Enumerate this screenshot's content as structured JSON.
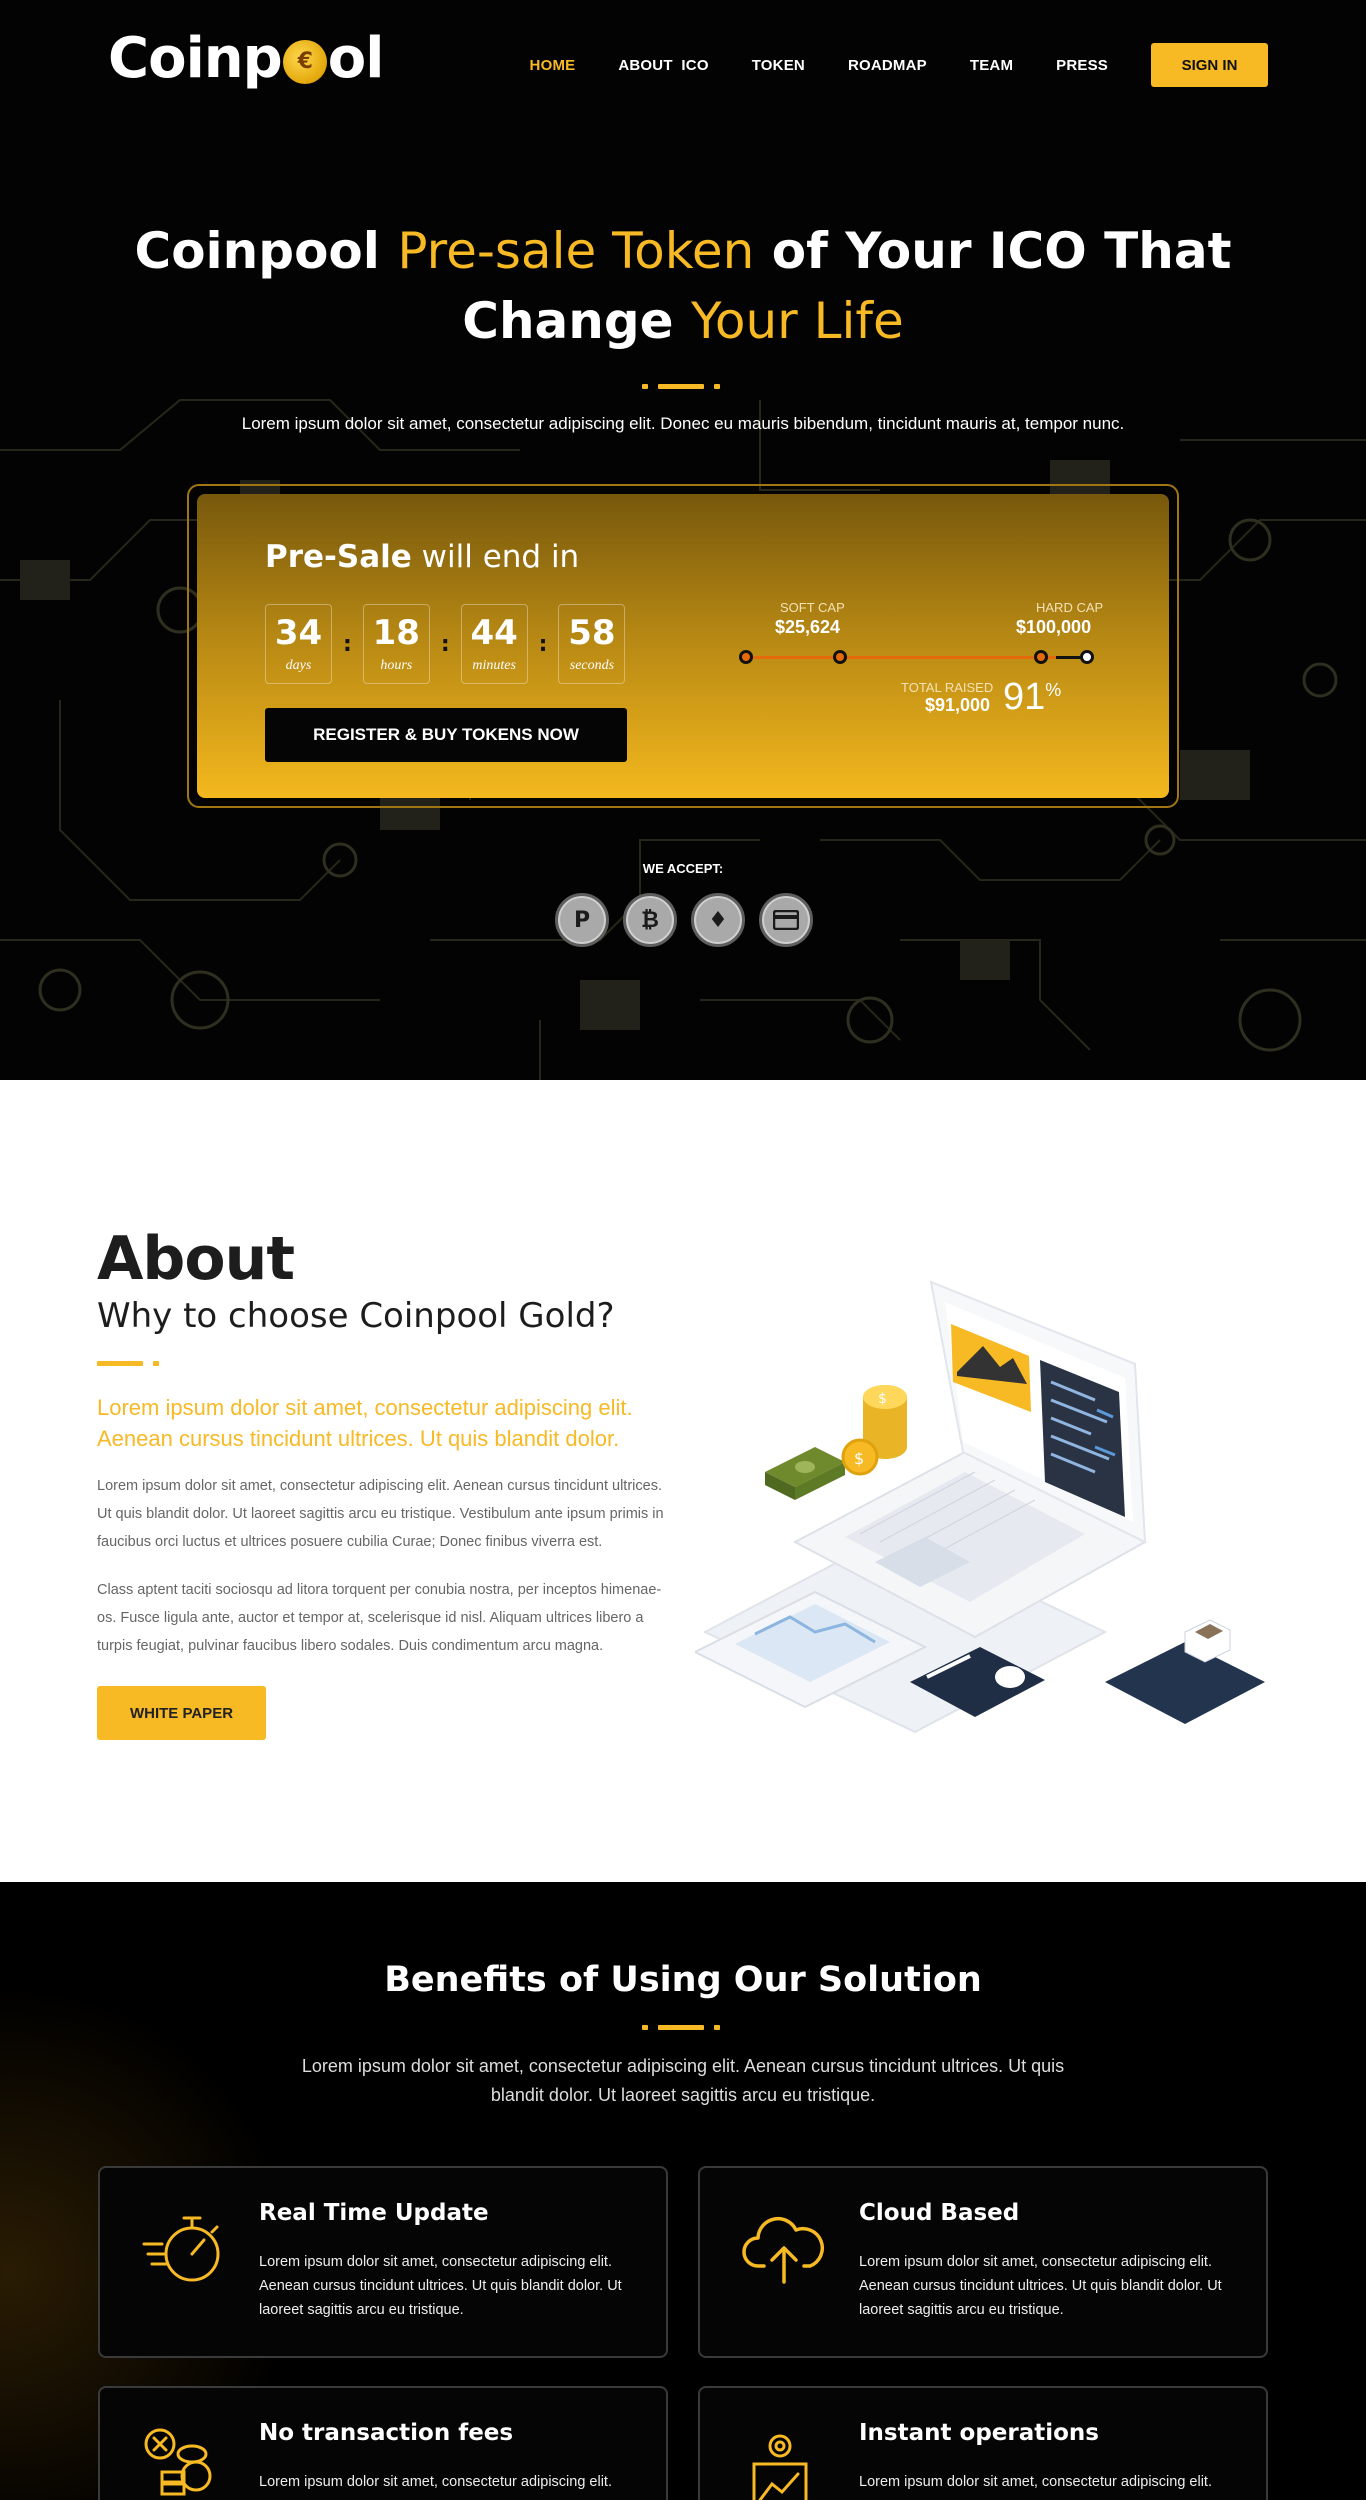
{
  "header": {
    "logo": {
      "pre": "Coinp",
      "post": "ol",
      "coin_glyph": "€"
    },
    "nav": [
      {
        "label": "HOME",
        "active": true
      },
      {
        "label": "ABOUT  ICO",
        "active": false
      },
      {
        "label": "TOKEN",
        "active": false
      },
      {
        "label": "ROADMAP",
        "active": false
      },
      {
        "label": "TEAM",
        "active": false
      },
      {
        "label": "PRESS",
        "active": false
      }
    ],
    "sign_in": "SIGN IN"
  },
  "hero": {
    "title_line1": {
      "a": "Coinpool",
      "b": "Pre-sale Token",
      "c": "of Your ICO That"
    },
    "title_line2": {
      "a": "Change",
      "b": "Your Life"
    },
    "subtitle": "Lorem ipsum dolor sit amet, consectetur adipiscing elit. Donec eu mauris bibendum, tincidunt mauris at, tempor nunc."
  },
  "presale": {
    "title_bold": "Pre-Sale",
    "title_rest": " will end in",
    "timer": [
      {
        "value": "34",
        "label": "days"
      },
      {
        "value": "18",
        "label": "hours"
      },
      {
        "value": "44",
        "label": "minutes"
      },
      {
        "value": "58",
        "label": "seconds"
      }
    ],
    "separator": ":",
    "button": "REGISTER & BUY TOKENS NOW",
    "soft_cap_label": "SOFT CAP",
    "soft_cap_value": "$25,624",
    "hard_cap_label": "HARD CAP",
    "hard_cap_value": "$100,000",
    "total_raised_label": "TOTAL RAISED",
    "total_raised_value": "$91,000",
    "percent": "91",
    "percent_sign": "%",
    "progress": 0.91
  },
  "accept": {
    "label": "WE ACCEPT:",
    "methods": [
      {
        "icon": "paypal-icon",
        "glyph": "P"
      },
      {
        "icon": "bitcoin-icon",
        "glyph": "₿"
      },
      {
        "icon": "ethereum-icon",
        "glyph": "♦"
      },
      {
        "icon": "credit-card-icon",
        "glyph": "▭"
      }
    ]
  },
  "about": {
    "heading": "About",
    "subheading": "Why to choose Coinpool Gold?",
    "lead": "Lorem ipsum dolor sit amet, consectetur adipiscing elit. Aenean cursus tincidunt ultrices. Ut quis blandit dolor.",
    "p1": "Lorem ipsum dolor sit amet, consectetur adipiscing elit. Aenean cursus tincidunt ultrices. Ut quis blandit dolor. Ut laoreet sagittis arcu eu tristique. Vestibulum ante ipsum primis in faucibus orci luctus et ultrices posuere cubilia Curae; Donec finibus viverra est.",
    "p2": "Class aptent taciti sociosqu ad litora torquent per conubia nostra, per inceptos himenae-os. Fusce ligula ante, auctor et tempor at, scelerisque id nisl. Aliquam ultrices libero a turpis feugiat, pulvinar faucibus libero sodales. Duis condimentum arcu magna.",
    "button": "WHITE PAPER"
  },
  "benefits": {
    "heading": "Benefits of Using Our Solution",
    "subtitle": "Lorem ipsum dolor sit amet, consectetur adipiscing elit. Aenean cursus tincidunt ultrices. Ut quis blandit dolor. Ut laoreet sagittis arcu eu tristique.",
    "cards": [
      {
        "title": "Real Time Update",
        "icon": "stopwatch-icon",
        "text": "Lorem ipsum dolor sit amet, consectetur adipiscing elit. Aenean cursus tincidunt ultrices. Ut quis blandit dolor. Ut laoreet sagittis arcu eu tristique."
      },
      {
        "title": "Cloud Based",
        "icon": "cloud-upload-icon",
        "text": "Lorem ipsum dolor sit amet, consectetur adipiscing elit. Aenean cursus tincidunt ultrices. Ut quis blandit dolor. Ut laoreet sagittis arcu eu tristique."
      },
      {
        "title": "No transaction fees",
        "icon": "no-fees-coins-icon",
        "text": "Lorem ipsum dolor sit amet, consectetur adipiscing elit."
      },
      {
        "title": "Instant operations",
        "icon": "instant-chart-icon",
        "text": "Lorem ipsum dolor sit amet, consectetur adipiscing elit."
      }
    ]
  },
  "colors": {
    "accent": "#f7b924",
    "dark": "#030303",
    "progress": "#e56a0a"
  }
}
